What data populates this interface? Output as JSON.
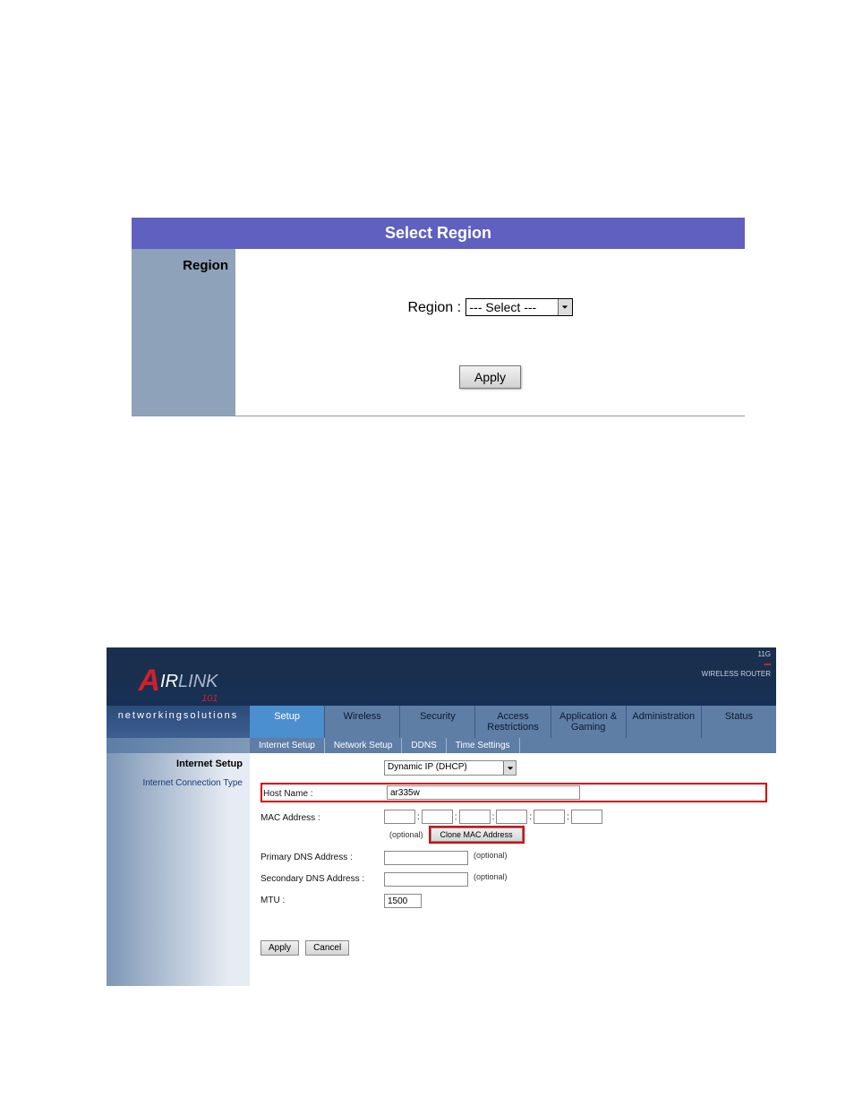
{
  "region_panel": {
    "header": "Select Region",
    "side_label": "Region",
    "label": "Region :",
    "select_value": "--- Select ---",
    "apply": "Apply"
  },
  "router": {
    "logo": {
      "brand_a": "A",
      "brand_ir": "IR",
      "brand_link": "LINK",
      "brand_101": "101",
      "tagline": "networkingsolutions"
    },
    "badge": {
      "line1": "11G",
      "line2": "WIRELESS ROUTER"
    },
    "tabs": [
      "Setup",
      "Wireless",
      "Security",
      "Access\nRestrictions",
      "Application &\nGaming",
      "Administration",
      "Status"
    ],
    "subtabs": [
      "Internet Setup",
      "Network Setup",
      "DDNS",
      "Time Settings"
    ],
    "left": {
      "heading": "Internet Setup",
      "subhead": "Internet Connection Type"
    },
    "form": {
      "conn_type": "Dynamic IP (DHCP)",
      "host_label": "Host Name :",
      "host_value": "ar335w",
      "mac_label": "MAC Address :",
      "optional": "(optional)",
      "clone": "Clone MAC Address",
      "pdns_label": "Primary DNS Address :",
      "sdns_label": "Secondary DNS Address :",
      "mtu_label": "MTU :",
      "mtu_value": "1500",
      "apply": "Apply",
      "cancel": "Cancel"
    }
  }
}
